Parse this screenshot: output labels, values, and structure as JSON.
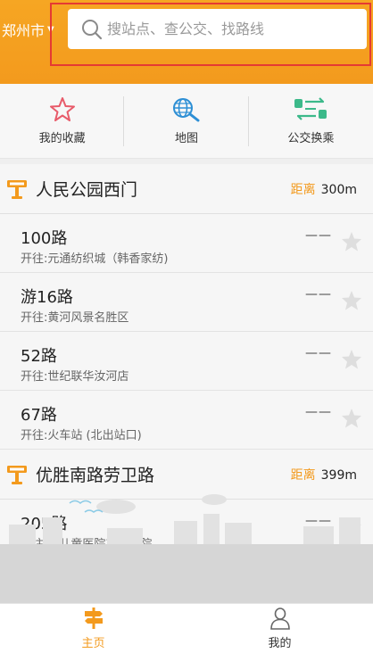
{
  "header": {
    "city": "郑州市",
    "search_placeholder": "搜站点、查公交、找路线"
  },
  "features": [
    {
      "label": "我的收藏",
      "icon": "star-icon"
    },
    {
      "label": "地图",
      "icon": "globe-search-icon"
    },
    {
      "label": "公交换乘",
      "icon": "bus-transfer-icon"
    }
  ],
  "stations": [
    {
      "name": "人民公园西门",
      "distance_label": "距离",
      "distance": "300m",
      "routes": [
        {
          "name": "100路",
          "dest": "开往:元通纺织城（韩香家纺)",
          "eta": "——"
        },
        {
          "name": "游16路",
          "dest": "开往:黄河风景名胜区",
          "eta": "——"
        },
        {
          "name": "52路",
          "dest": "开往:世纪联华汝河店",
          "eta": "——"
        },
        {
          "name": "67路",
          "dest": "开往:火车站 (北出站口)",
          "eta": "——"
        }
      ]
    },
    {
      "name": "优胜南路劳卫路",
      "distance_label": "距离",
      "distance": "399m",
      "routes": [
        {
          "name": "205路",
          "dest": "开往:市儿童医院东区医院",
          "eta": "——"
        }
      ]
    }
  ],
  "tabbar": {
    "home": "主页",
    "mine": "我的"
  },
  "colors": {
    "accent": "#f39a1d",
    "highlight": "#e53a33"
  }
}
